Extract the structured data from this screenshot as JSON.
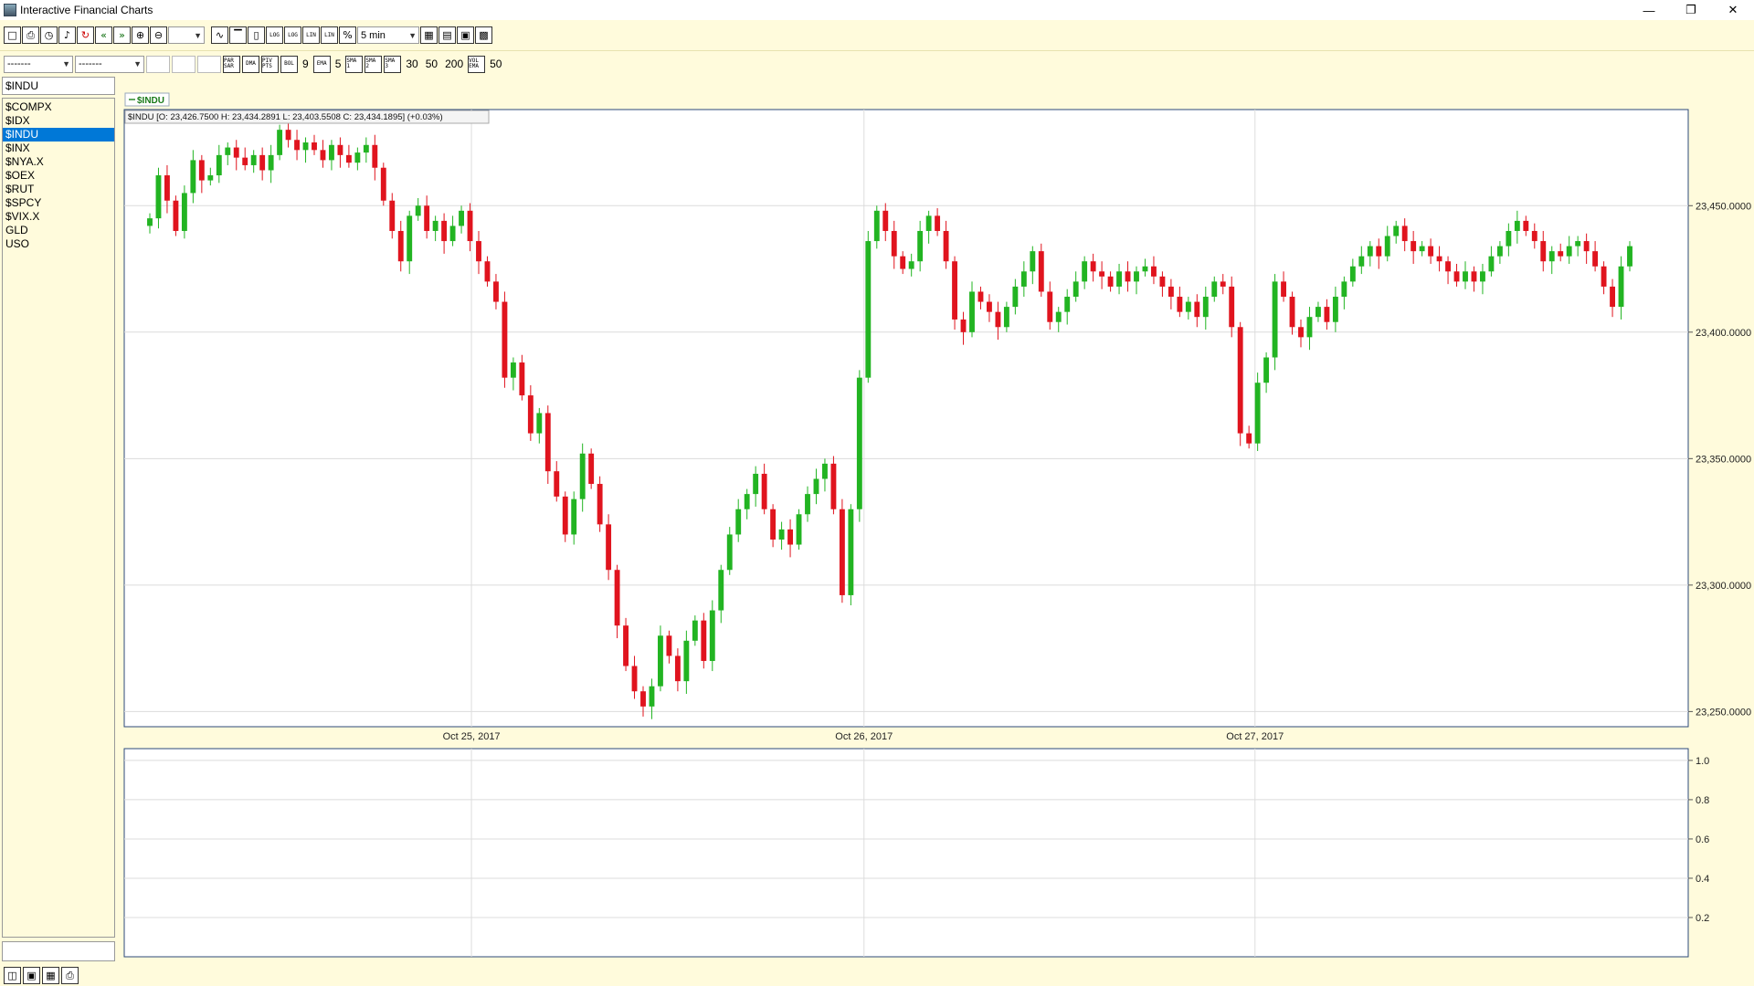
{
  "window": {
    "title": "Interactive Financial Charts"
  },
  "toolbar": {
    "interval": "5 min",
    "log_btn_1": "LOG",
    "log_btn_2": "LOG",
    "lin_btn_1": "LIN",
    "lin_btn_2": "LIN",
    "pct_btn": "%",
    "par_sar": "PAR SAR",
    "dma": "DMA",
    "piv_pts": "PIV PTS",
    "bol": "BOL",
    "bol_value": "9",
    "ema": "EMA",
    "ema_value": "5",
    "sma1": "SMA 1",
    "sma2": "SMA 2",
    "sma3": "SMA 3",
    "sma1_value": "30",
    "sma2_value": "50",
    "sma3_value": "200",
    "vol_ema": "VOL EMA",
    "vol_ema_value": "50",
    "select_1": "-------",
    "select_2": "-------"
  },
  "sidebar": {
    "symbol_input": "$INDU",
    "symbols": [
      "$COMPX",
      "$IDX",
      "$INDU",
      "$INX",
      "$NYA.X",
      "$OEX",
      "$RUT",
      "$SPCY",
      "$VIX.X",
      "GLD",
      "USO"
    ],
    "selected_index": 2
  },
  "chart_data": {
    "type": "candlestick",
    "legend": "$INDU",
    "info_label": "$INDU [O: 23,426.7500  H: 23,434.2891  L: 23,403.5508  C: 23,434.1895] (+0.03%)",
    "y_ticks": [
      "23,450.0000",
      "23,400.0000",
      "23,350.0000",
      "23,300.0000",
      "23,250.0000"
    ],
    "y_tick_values": [
      23450,
      23400,
      23350,
      23300,
      23250
    ],
    "ylim": [
      23244,
      23488
    ],
    "x_ticks": [
      "Oct 25, 2017",
      "Oct 26, 2017",
      "Oct 27, 2017"
    ],
    "up_color": "#22b422",
    "down_color": "#e0141e",
    "closes": [
      23445,
      23462,
      23452,
      23440,
      23455,
      23468,
      23460,
      23462,
      23470,
      23473,
      23469,
      23466,
      23470,
      23464,
      23470,
      23480,
      23476,
      23472,
      23475,
      23472,
      23468,
      23474,
      23470,
      23467,
      23471,
      23474,
      23465,
      23452,
      23440,
      23428,
      23446,
      23450,
      23440,
      23444,
      23436,
      23442,
      23448,
      23436,
      23428,
      23420,
      23412,
      23382,
      23388,
      23375,
      23360,
      23368,
      23345,
      23335,
      23320,
      23334,
      23352,
      23340,
      23324,
      23306,
      23284,
      23268,
      23258,
      23252,
      23260,
      23280,
      23272,
      23262,
      23278,
      23286,
      23270,
      23290,
      23306,
      23320,
      23330,
      23336,
      23344,
      23330,
      23318,
      23322,
      23316,
      23328,
      23336,
      23342,
      23348,
      23330,
      23296,
      23330,
      23382,
      23436,
      23448,
      23440,
      23430,
      23425,
      23428,
      23440,
      23446,
      23440,
      23428,
      23405,
      23400,
      23416,
      23412,
      23408,
      23402,
      23410,
      23418,
      23424,
      23432,
      23416,
      23404,
      23408,
      23414,
      23420,
      23428,
      23424,
      23422,
      23418,
      23424,
      23420,
      23424,
      23426,
      23422,
      23418,
      23414,
      23408,
      23412,
      23406,
      23414,
      23420,
      23418,
      23402,
      23360,
      23356,
      23380,
      23390,
      23420,
      23414,
      23402,
      23398,
      23406,
      23410,
      23404,
      23414,
      23420,
      23426,
      23430,
      23434,
      23430,
      23438,
      23442,
      23436,
      23432,
      23434,
      23430,
      23428,
      23424,
      23420,
      23424,
      23420,
      23424,
      23430,
      23434,
      23440,
      23444,
      23440,
      23436,
      23428,
      23432,
      23430,
      23434,
      23436,
      23432,
      23426,
      23418,
      23410,
      23426,
      23434
    ]
  },
  "sub_panel": {
    "y_ticks": [
      "1.0",
      "0.8",
      "0.6",
      "0.4",
      "0.2"
    ],
    "y_tick_values": [
      1.0,
      0.8,
      0.6,
      0.4,
      0.2
    ],
    "ylim": [
      0.0,
      1.06
    ]
  }
}
